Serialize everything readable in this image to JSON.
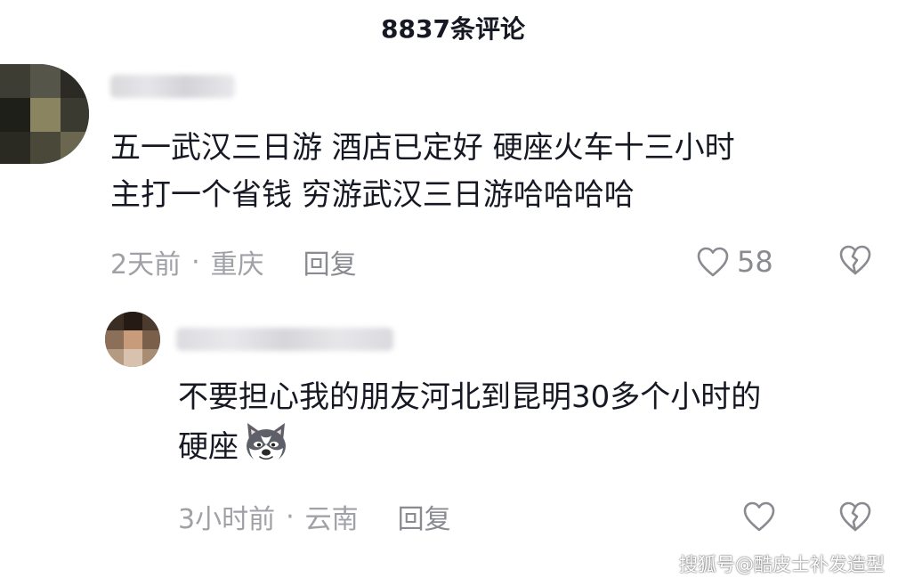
{
  "header": {
    "title": "8837条评论"
  },
  "comments": [
    {
      "lines": [
        "五一武汉三日游  酒店已定好  硬座火车十三小时",
        "主打一个省钱  穷游武汉三日游哈哈哈哈"
      ],
      "time": "2天前",
      "location": "重庆",
      "reply_label": "回复",
      "like_count": "58",
      "like_icon": "heart-outline-icon",
      "dislike_icon": "broken-heart-icon"
    },
    {
      "lines": [
        "不要担心我的朋友河北到昆明30多个小时的",
        "硬座"
      ],
      "emoji": "husky-dog-emoji",
      "time": "3小时前",
      "location": "云南",
      "reply_label": "回复",
      "like_icon": "heart-outline-icon",
      "dislike_icon": "broken-heart-icon"
    }
  ],
  "watermark": "搜狐号@酷皮士补发造型",
  "colors": {
    "text": "#161823",
    "meta": "#a0a1a6",
    "icon": "#8a8b91"
  }
}
